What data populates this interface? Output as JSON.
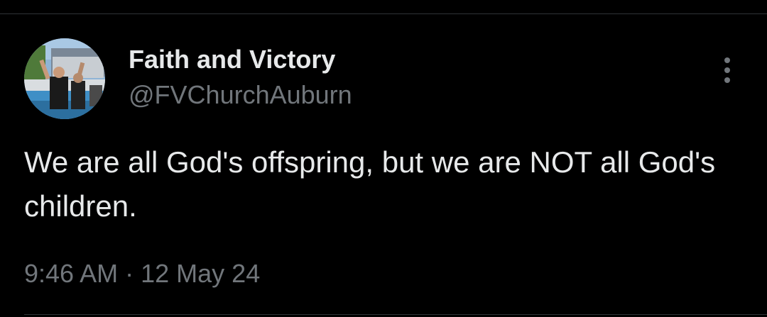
{
  "tweet": {
    "author": {
      "display_name": "Faith and Victory",
      "handle": "@FVChurchAuburn"
    },
    "text": "We are all God's offspring, but we are NOT all God's children.",
    "time": "9:46 AM",
    "separator": "·",
    "date": "12 May 24"
  },
  "icons": {
    "more": "more-vertical-icon",
    "avatar": "avatar-image"
  },
  "colors": {
    "background": "#000000",
    "primary_text": "#e7e9ea",
    "secondary_text": "#71767b",
    "divider": "#2f3336"
  }
}
